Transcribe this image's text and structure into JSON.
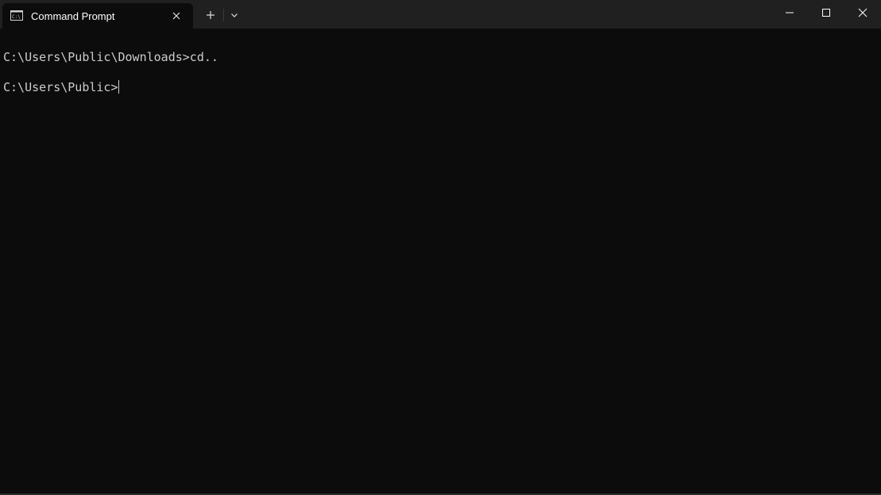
{
  "tab": {
    "title": "Command Prompt",
    "icon": "command-prompt-icon"
  },
  "titlebar": {
    "new_tab_icon": "plus-icon",
    "dropdown_icon": "chevron-down-icon",
    "window_controls": [
      "minimize-icon",
      "maximize-icon",
      "close-icon"
    ]
  },
  "terminal": {
    "lines": [
      "C:\\Users\\Public\\Downloads>cd..",
      "C:\\Users\\Public>"
    ]
  },
  "colors": {
    "background": "#0c0c0c",
    "titlebar": "#202020",
    "text": "#cccccc"
  }
}
